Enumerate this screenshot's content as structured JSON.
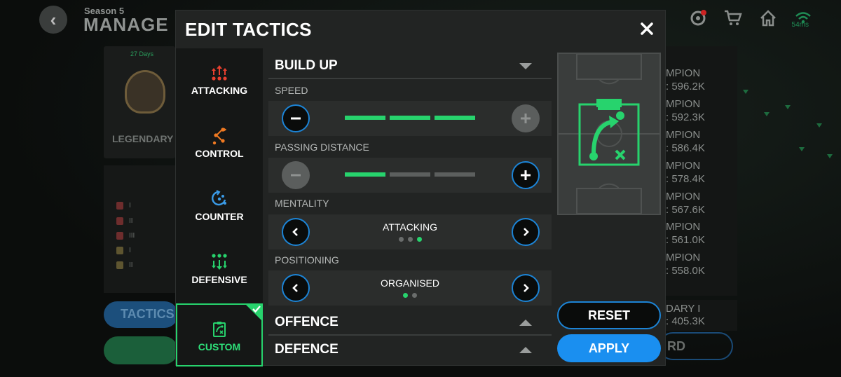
{
  "background": {
    "season": "Season 5",
    "title": "MANAGE",
    "days": "27 Days",
    "league_label": "LEGENDARY",
    "ping": "54ms",
    "tactics_button": "TACTICS",
    "rank_rows": [
      "I",
      "II",
      "III",
      "I",
      "II"
    ],
    "champion_rows": [
      {
        "name": "MPION",
        "value": ": 596.2K"
      },
      {
        "name": "MPION",
        "value": ": 592.3K"
      },
      {
        "name": "MPION",
        "value": ": 586.4K"
      },
      {
        "name": "MPION",
        "value": ": 578.4K"
      },
      {
        "name": "MPION",
        "value": ": 567.6K"
      },
      {
        "name": "MPION",
        "value": ": 561.0K"
      },
      {
        "name": "MPION",
        "value": ": 558.0K"
      }
    ],
    "bottom_rank": {
      "name": "DARY I",
      "value": ": 405.3K"
    },
    "bottom_button": "RD"
  },
  "modal": {
    "title": "EDIT TACTICS",
    "close_icon": "close-icon"
  },
  "sidebar": {
    "items": [
      {
        "label": "ATTACKING",
        "icon": "attacking-icon",
        "color": "#e8402f"
      },
      {
        "label": "CONTROL",
        "icon": "control-icon",
        "color": "#f07a22"
      },
      {
        "label": "COUNTER",
        "icon": "counter-icon",
        "color": "#3a9be8"
      },
      {
        "label": "DEFENSIVE",
        "icon": "defensive-icon",
        "color": "#27d36d"
      },
      {
        "label": "CUSTOM",
        "icon": "custom-icon",
        "color": "#27d36d",
        "selected": true
      }
    ]
  },
  "sections": {
    "build_up": "BUILD UP",
    "offence": "OFFENCE",
    "defence": "DEFENCE"
  },
  "settings": {
    "speed": {
      "label": "SPEED",
      "level": 3,
      "max": 3
    },
    "passing_distance": {
      "label": "PASSING DISTANCE",
      "level": 1,
      "max": 3
    },
    "mentality": {
      "label": "MENTALITY",
      "value": "ATTACKING",
      "index": 3,
      "count": 3
    },
    "positioning": {
      "label": "POSITIONING",
      "value": "ORGANISED",
      "index": 1,
      "count": 2
    }
  },
  "actions": {
    "reset": "RESET",
    "apply": "APPLY"
  },
  "colors": {
    "accent_green": "#27d36d",
    "accent_blue": "#1c84d6",
    "apply_blue": "#1a8ff0"
  }
}
